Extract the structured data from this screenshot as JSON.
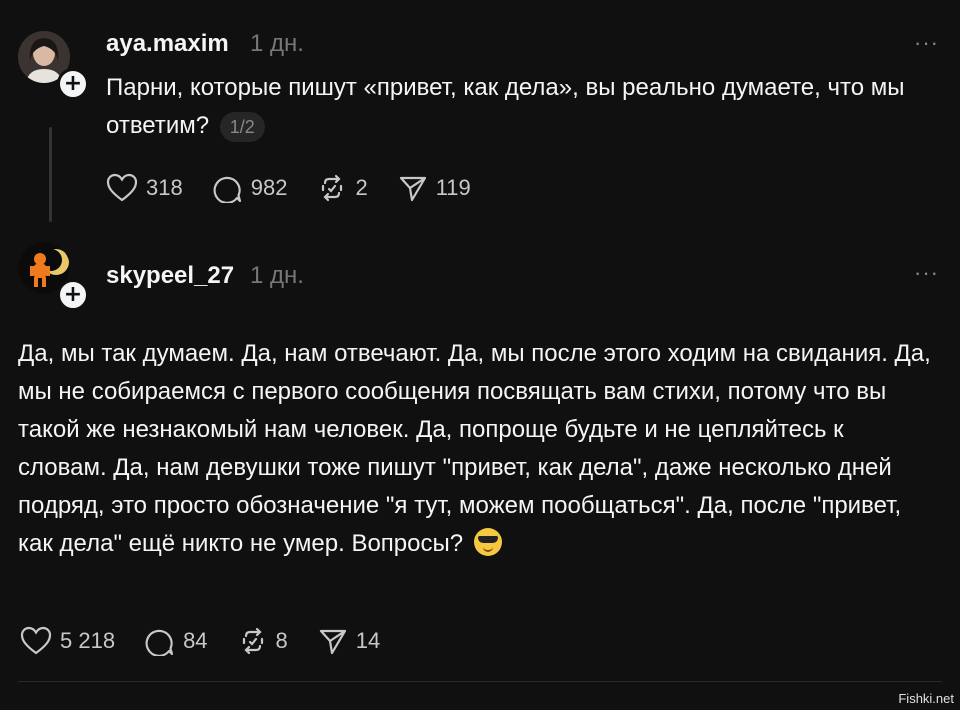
{
  "posts": [
    {
      "username": "aya.maxim",
      "time": "1 дн.",
      "more": "···",
      "text": "Парни, которые пишут «привет, как дела», вы реально думаете, что мы ответим?",
      "page": "1/2",
      "likes": "318",
      "comments": "982",
      "reposts": "2",
      "shares": "119"
    },
    {
      "username": "skypeel_27",
      "time": "1 дн.",
      "more": "···",
      "text": "Да, мы так думаем. Да, нам отвечают. Да, мы после этого ходим на свидания. Да, мы не собираемся с первого сообщения посвящать вам стихи, потому что вы такой же незнакомый нам человек. Да, попроще будьте и не цепляйтесь к словам. Да, нам девушки тоже пишут \"привет, как дела\", даже несколько дней подряд, это просто обозначение \"я тут, можем пообщаться\". Да, после \"привет, как дела\" ещё никто не умер. Вопросы?",
      "likes": "5 218",
      "comments": "84",
      "reposts": "8",
      "shares": "14"
    }
  ],
  "icons": {
    "like": "heart-icon",
    "comment": "comment-bubble-icon",
    "repost": "repost-icon",
    "share": "send-icon",
    "emoji": "smiling-face-with-sunglasses"
  },
  "watermark": "Fishki.net"
}
